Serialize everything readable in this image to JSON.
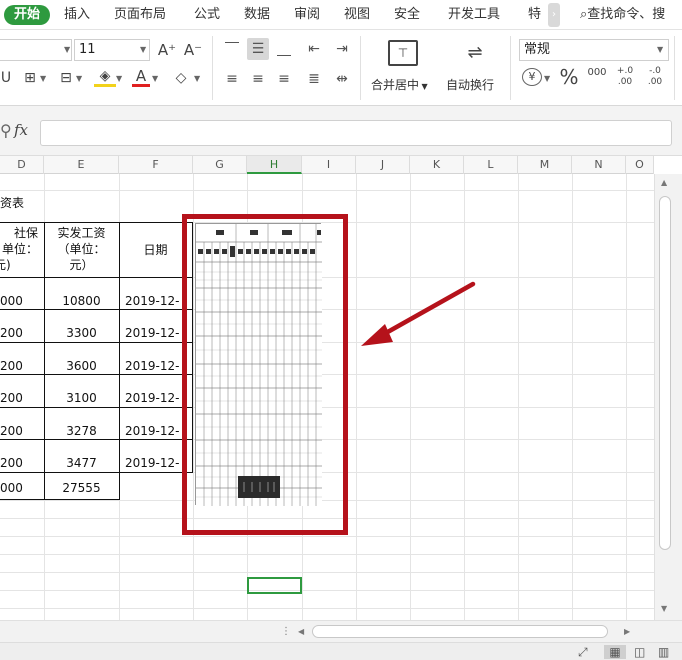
{
  "menu": {
    "tabs": [
      "开始",
      "插入",
      "页面布局",
      "公式",
      "数据",
      "审阅",
      "视图",
      "安全",
      "开发工具",
      "特"
    ],
    "more": "›",
    "search": "查找命令、搜"
  },
  "ribbon": {
    "font_size": "11",
    "grow_font": "A⁺",
    "shrink_font": "A⁻",
    "merge_label": "合并居中",
    "wrap_label": "自动换行",
    "number_format": "常规",
    "currency": "¥",
    "percent": "%",
    "thousands": "000",
    "inc_decimal": "+.0 .00",
    "dec_decimal": "-.0 .00"
  },
  "formula_bar": {
    "fx": "fx"
  },
  "columns": [
    "D",
    "E",
    "F",
    "G",
    "H",
    "I",
    "J",
    "K",
    "L",
    "M",
    "N",
    "O"
  ],
  "selected_column": "H",
  "sheet": {
    "title_fragment": "资表",
    "headers": {
      "d": [
        "社保",
        "单位：",
        "元)"
      ],
      "e": [
        "实发工资",
        "（单位：",
        "元）"
      ],
      "f": "日期"
    },
    "rows": [
      {
        "d": "000",
        "e": "10800",
        "f": "2019-12-"
      },
      {
        "d": "200",
        "e": "3300",
        "f": "2019-12-"
      },
      {
        "d": "200",
        "e": "3600",
        "f": "2019-12-"
      },
      {
        "d": "200",
        "e": "3100",
        "f": "2019-12-"
      },
      {
        "d": "200",
        "e": "3278",
        "f": "2019-12-"
      },
      {
        "d": "200",
        "e": "3477",
        "f": "2019-12-"
      }
    ],
    "total": {
      "d": "000",
      "e": "27555"
    }
  },
  "colors": {
    "accent": "#2e9a3f",
    "highlight": "#b5121b",
    "arrow": "#b5121b"
  }
}
